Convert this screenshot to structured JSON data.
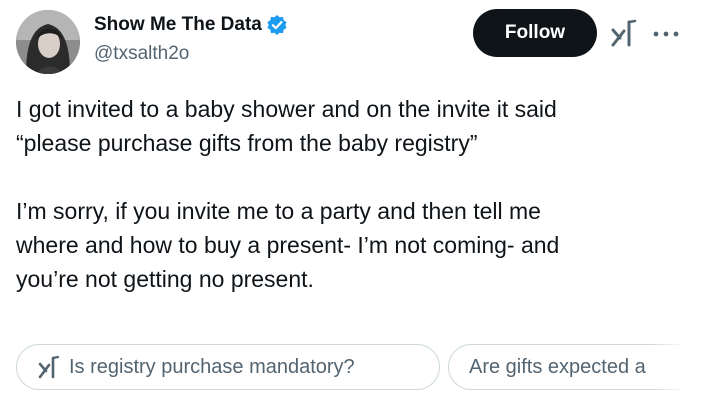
{
  "author": {
    "display_name": "Show Me The Data",
    "handle": "@txsalth2o",
    "verified": true,
    "verified_color": "#1d9bf0"
  },
  "actions": {
    "follow_label": "Follow"
  },
  "icons": {
    "verified": "verified-badge-icon",
    "grok": "grok-icon",
    "more": "more-options-icon"
  },
  "tweet": {
    "text": "I got invited to a baby shower and on the invite it said\n“please purchase gifts from the baby registry”\n\nI’m sorry, if you invite me to a party and then tell me\nwhere and how to buy a present- I’m not coming- and\nyou’re not getting no present."
  },
  "suggestions": [
    {
      "label": "Is registry purchase mandatory?"
    },
    {
      "label": "Are gifts expected a"
    }
  ],
  "colors": {
    "text_primary": "#0f1419",
    "text_secondary": "#536471",
    "chip_border": "#cfd9de",
    "follow_bg": "#0f1419"
  }
}
